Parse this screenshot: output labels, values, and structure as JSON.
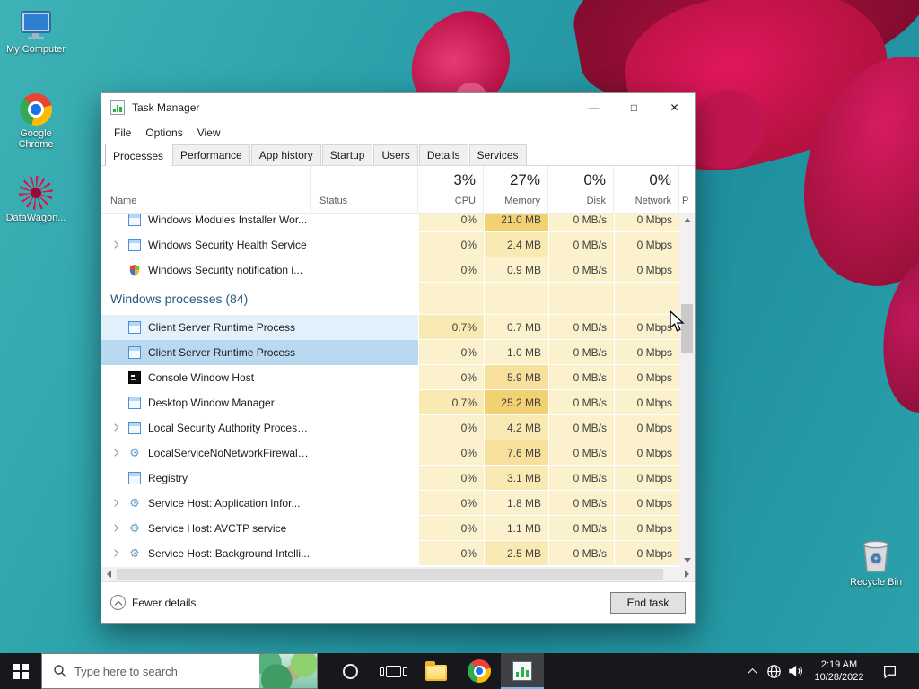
{
  "desktop": {
    "icons": [
      {
        "label": "My Computer"
      },
      {
        "label": "Google Chrome"
      },
      {
        "label": "DataWagon..."
      },
      {
        "label": "Recycle Bin"
      }
    ]
  },
  "taskmanager": {
    "title": "Task Manager",
    "controls": {
      "minimize": "—",
      "maximize": "□",
      "close": "✕"
    },
    "menus": [
      "File",
      "Options",
      "View"
    ],
    "tabs": [
      "Processes",
      "Performance",
      "App history",
      "Startup",
      "Users",
      "Details",
      "Services"
    ],
    "header": {
      "name": "Name",
      "status": "Status",
      "cpu_usage": "3%",
      "cpu": "CPU",
      "memory_usage": "27%",
      "memory": "Memory",
      "disk_usage": "0%",
      "disk": "Disk",
      "network_usage": "0%",
      "network": "Network",
      "partial_next": "P"
    },
    "group_header": "Windows processes (84)",
    "rows": [
      {
        "name": "Windows Modules Installer Wor...",
        "cpu": "0%",
        "memory": "21.0 MB",
        "disk": "0 MB/s",
        "network": "0 Mbps"
      },
      {
        "name": "Windows Security Health Service",
        "cpu": "0%",
        "memory": "2.4 MB",
        "disk": "0 MB/s",
        "network": "0 Mbps"
      },
      {
        "name": "Windows Security notification i...",
        "cpu": "0%",
        "memory": "0.9 MB",
        "disk": "0 MB/s",
        "network": "0 Mbps"
      },
      {
        "name": "Client Server Runtime Process",
        "cpu": "0.7%",
        "memory": "0.7 MB",
        "disk": "0 MB/s",
        "network": "0 Mbps"
      },
      {
        "name": "Client Server Runtime Process",
        "cpu": "0%",
        "memory": "1.0 MB",
        "disk": "0 MB/s",
        "network": "0 Mbps"
      },
      {
        "name": "Console Window Host",
        "cpu": "0%",
        "memory": "5.9 MB",
        "disk": "0 MB/s",
        "network": "0 Mbps"
      },
      {
        "name": "Desktop Window Manager",
        "cpu": "0.7%",
        "memory": "25.2 MB",
        "disk": "0 MB/s",
        "network": "0 Mbps"
      },
      {
        "name": "Local Security Authority Process...",
        "cpu": "0%",
        "memory": "4.2 MB",
        "disk": "0 MB/s",
        "network": "0 Mbps"
      },
      {
        "name": "LocalServiceNoNetworkFirewall ...",
        "cpu": "0%",
        "memory": "7.6 MB",
        "disk": "0 MB/s",
        "network": "0 Mbps"
      },
      {
        "name": "Registry",
        "cpu": "0%",
        "memory": "3.1 MB",
        "disk": "0 MB/s",
        "network": "0 Mbps"
      },
      {
        "name": "Service Host: Application Infor...",
        "cpu": "0%",
        "memory": "1.8 MB",
        "disk": "0 MB/s",
        "network": "0 Mbps"
      },
      {
        "name": "Service Host: AVCTP service",
        "cpu": "0%",
        "memory": "1.1 MB",
        "disk": "0 MB/s",
        "network": "0 Mbps"
      },
      {
        "name": "Service Host: Background Intelli...",
        "cpu": "0%",
        "memory": "2.5 MB",
        "disk": "0 MB/s",
        "network": "0 Mbps"
      }
    ],
    "footer": {
      "details_toggle": "Fewer details",
      "end_task": "End task"
    }
  },
  "taskbar": {
    "search_placeholder": "Type here to search",
    "clock": {
      "time": "2:19 AM",
      "date": "10/28/2022"
    }
  }
}
